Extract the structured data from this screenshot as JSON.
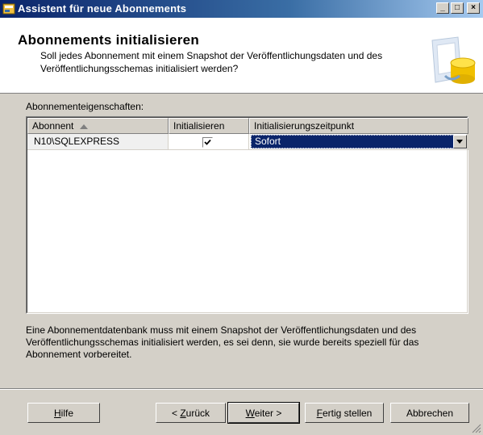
{
  "window": {
    "title": "Assistent für neue Abonnements",
    "controls": {
      "minimize": "_",
      "maximize": "□",
      "close": "×"
    }
  },
  "header": {
    "title": "Abonnements initialisieren",
    "subtitle": "Soll jedes Abonnement mit einem Snapshot der Veröffentlichungsdaten und des Veröffentlichungsschemas initialisiert werden?",
    "graphic_icon": "database-icon"
  },
  "properties": {
    "label": "Abonnementeigenschaften:",
    "columns": [
      "Abonnent",
      "Initialisieren",
      "Initialisierungszeitpunkt"
    ],
    "sort_column": "Abonnent",
    "rows": [
      {
        "subscriber": "N10\\SQLEXPRESS",
        "initialize": true,
        "timing": "Sofort"
      }
    ]
  },
  "info_text": "Eine Abonnementdatenbank muss mit einem Snapshot der Veröffentlichungsdaten und des Veröffentlichungsschemas initialisiert werden, es sei denn, sie wurde bereits speziell für das Abonnement vorbereitet.",
  "buttons": {
    "help": {
      "prefix": "",
      "mnemonic": "H",
      "suffix": "ilfe"
    },
    "back": {
      "prefix": "< ",
      "mnemonic": "Z",
      "suffix": "urück"
    },
    "next": {
      "prefix": "",
      "mnemonic": "W",
      "suffix": "eiter >"
    },
    "finish": {
      "prefix": "",
      "mnemonic": "F",
      "suffix": "ertig stellen"
    },
    "cancel": {
      "label": "Abbrechen"
    }
  },
  "colors": {
    "titlebar": "#0a246a",
    "selection": "#0a246a",
    "face": "#d4d0c8"
  }
}
